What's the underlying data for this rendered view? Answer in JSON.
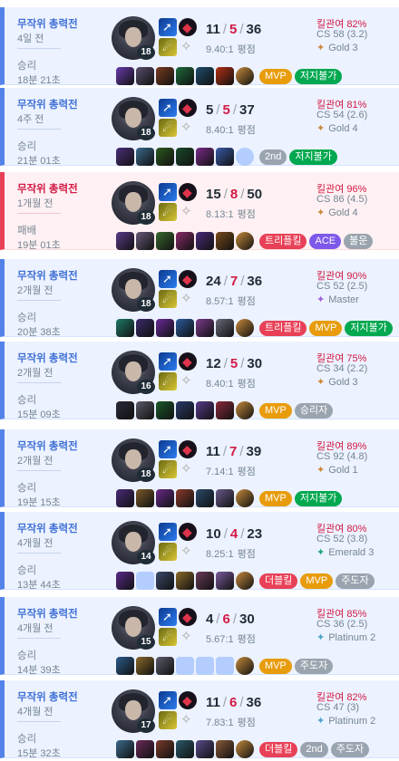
{
  "matches": [
    {
      "result_type": "win",
      "mode": "무작위 총력전",
      "time_ago": "4일 전",
      "result": "승리",
      "duration": "18분 21초",
      "level": "18",
      "kills": "11",
      "deaths": "5",
      "assists": "36",
      "ratio": "9.40:1",
      "ratio_suffix": "평점",
      "kp_label": "킬관여",
      "kp": "82%",
      "cs": "CS 58 (3.2)",
      "tier": "Gold 3",
      "items": [
        {
          "color": "#6a3bb0"
        },
        {
          "color": "#5a4f6c"
        },
        {
          "color": "#7a3b1f"
        },
        {
          "color": "#1e6b3c"
        },
        {
          "color": "#1f4d6e"
        },
        {
          "color": "#b43014"
        },
        {
          "color": "#c68a3c",
          "ward": true
        }
      ],
      "badges": [
        {
          "label": "MVP",
          "color": "#e89c0c"
        },
        {
          "label": "저지불가",
          "color": "#00a84f"
        }
      ]
    },
    {
      "result_type": "win",
      "mode": "무작위 총력전",
      "time_ago": "4주 전",
      "result": "승리",
      "duration": "21분 01초",
      "level": "18",
      "kills": "5",
      "deaths": "5",
      "assists": "37",
      "ratio": "8.40:1",
      "ratio_suffix": "평점",
      "kp_label": "킬관여",
      "kp": "81%",
      "cs": "CS 54 (2.6)",
      "tier": "Gold 4",
      "items": [
        {
          "color": "#4b2f7a"
        },
        {
          "color": "#3a6a8c"
        },
        {
          "color": "#2d5a1f"
        },
        {
          "color": "#1a4a2a"
        },
        {
          "color": "#7a2b8a"
        },
        {
          "color": "#3a5aa8"
        },
        {
          "color": "#b3cdff",
          "empty": true,
          "ward": true
        }
      ],
      "badges": [
        {
          "label": "2nd",
          "color": "#9aa4af"
        },
        {
          "label": "저지불가",
          "color": "#00a84f"
        }
      ]
    },
    {
      "result_type": "loss",
      "mode": "무작위 총력전",
      "time_ago": "1개월 전",
      "result": "패배",
      "duration": "19분 01초",
      "level": "18",
      "kills": "15",
      "deaths": "8",
      "assists": "50",
      "ratio": "8.13:1",
      "ratio_suffix": "평점",
      "kp_label": "킬관여",
      "kp": "96%",
      "cs": "CS 86 (4.5)",
      "tier": "Gold 4",
      "items": [
        {
          "color": "#5b3a8a"
        },
        {
          "color": "#6a5a7a"
        },
        {
          "color": "#3a6a2f"
        },
        {
          "color": "#8a2a6a"
        },
        {
          "color": "#4a2a7a"
        },
        {
          "color": "#7a4a1a"
        },
        {
          "color": "#c68a3c",
          "ward": true
        }
      ],
      "badges": [
        {
          "label": "트리플킬",
          "color": "#e84057"
        },
        {
          "label": "ACE",
          "color": "#7d59ea"
        },
        {
          "label": "불운",
          "color": "#9aa4af"
        }
      ]
    },
    {
      "result_type": "win",
      "mode": "무작위 총력전",
      "time_ago": "2개월 전",
      "result": "승리",
      "duration": "20분 38초",
      "level": "18",
      "kills": "24",
      "deaths": "7",
      "assists": "36",
      "ratio": "8.57:1",
      "ratio_suffix": "평점",
      "kp_label": "킬관여",
      "kp": "90%",
      "cs": "CS 52 (2.5)",
      "tier": "Master",
      "items": [
        {
          "color": "#1f7a6a"
        },
        {
          "color": "#3a2a6a"
        },
        {
          "color": "#6a2a9a"
        },
        {
          "color": "#2a5a9a"
        },
        {
          "color": "#7a3a8a"
        },
        {
          "color": "#6a6a7a"
        },
        {
          "color": "#c68a3c",
          "ward": true
        }
      ],
      "badges": [
        {
          "label": "트리플킬",
          "color": "#e84057"
        },
        {
          "label": "MVP",
          "color": "#e89c0c"
        },
        {
          "label": "저지불가",
          "color": "#00a84f"
        }
      ]
    },
    {
      "result_type": "win",
      "mode": "무작위 총력전",
      "time_ago": "2개월 전",
      "result": "승리",
      "duration": "15분 09초",
      "level": "16",
      "kills": "12",
      "deaths": "5",
      "assists": "30",
      "ratio": "8.40:1",
      "ratio_suffix": "평점",
      "kp_label": "킬관여",
      "kp": "75%",
      "cs": "CS 34 (2.2)",
      "tier": "Gold 3",
      "items": [
        {
          "color": "#2a2a3a"
        },
        {
          "color": "#5a5a6a"
        },
        {
          "color": "#1a5a2a"
        },
        {
          "color": "#2a3a6a"
        },
        {
          "color": "#5a3a8a"
        },
        {
          "color": "#8a2a3a"
        },
        {
          "color": "#c68a3c",
          "ward": true
        }
      ],
      "badges": [
        {
          "label": "MVP",
          "color": "#e89c0c"
        },
        {
          "label": "승리자",
          "color": "#9aa4af"
        }
      ]
    },
    {
      "result_type": "win",
      "mode": "무작위 총력전",
      "time_ago": "2개월 전",
      "result": "승리",
      "duration": "19분 15초",
      "level": "18",
      "kills": "11",
      "deaths": "7",
      "assists": "39",
      "ratio": "7.14:1",
      "ratio_suffix": "평점",
      "kp_label": "킬관여",
      "kp": "89%",
      "cs": "CS 92 (4.8)",
      "tier": "Gold 1",
      "items": [
        {
          "color": "#4a2a7a"
        },
        {
          "color": "#7a5a2a"
        },
        {
          "color": "#6a2a8a"
        },
        {
          "color": "#8a3a2a"
        },
        {
          "color": "#2a4a6a"
        },
        {
          "color": "#6a5a8a"
        },
        {
          "color": "#c68a3c",
          "ward": true
        }
      ],
      "badges": [
        {
          "label": "MVP",
          "color": "#e89c0c"
        },
        {
          "label": "저지불가",
          "color": "#00a84f"
        }
      ]
    },
    {
      "result_type": "win",
      "mode": "무작위 총력전",
      "time_ago": "4개월 전",
      "result": "승리",
      "duration": "13분 44초",
      "level": "14",
      "kills": "10",
      "deaths": "4",
      "assists": "23",
      "ratio": "8.25:1",
      "ratio_suffix": "평점",
      "kp_label": "킬관여",
      "kp": "80%",
      "cs": "CS 52 (3.8)",
      "tier": "Emerald 3",
      "items": [
        {
          "color": "#5a2a8a"
        },
        {
          "color": "#b3cdff",
          "empty": true
        },
        {
          "color": "#3a4a6a"
        },
        {
          "color": "#8a6a2a"
        },
        {
          "color": "#6a3a5a"
        },
        {
          "color": "#7a5a9a"
        },
        {
          "color": "#c68a3c",
          "ward": true
        }
      ],
      "badges": [
        {
          "label": "더블킬",
          "color": "#e84057"
        },
        {
          "label": "MVP",
          "color": "#e89c0c"
        },
        {
          "label": "주도자",
          "color": "#9aa4af"
        }
      ]
    },
    {
      "result_type": "win",
      "mode": "무작위 총력전",
      "time_ago": "4개월 전",
      "result": "승리",
      "duration": "14분 39초",
      "level": "15",
      "kills": "4",
      "deaths": "6",
      "assists": "30",
      "ratio": "5.67:1",
      "ratio_suffix": "평점",
      "kp_label": "킬관여",
      "kp": "85%",
      "cs": "CS 36 (2.5)",
      "tier": "Platinum 2",
      "items": [
        {
          "color": "#2a5a8a"
        },
        {
          "color": "#8a6a2a"
        },
        {
          "color": "#5a5a6a"
        },
        {
          "color": "#b3cdff",
          "empty": true
        },
        {
          "color": "#b3cdff",
          "empty": true
        },
        {
          "color": "#b3cdff",
          "empty": true
        },
        {
          "color": "#c68a3c",
          "ward": true
        }
      ],
      "badges": [
        {
          "label": "MVP",
          "color": "#e89c0c"
        },
        {
          "label": "주도자",
          "color": "#9aa4af"
        }
      ]
    },
    {
      "result_type": "win",
      "mode": "무작위 총력전",
      "time_ago": "4개월 전",
      "result": "승리",
      "duration": "15분 32초",
      "level": "17",
      "kills": "11",
      "deaths": "6",
      "assists": "36",
      "ratio": "7.83:1",
      "ratio_suffix": "평점",
      "kp_label": "킬관여",
      "kp": "82%",
      "cs": "CS 47 (3)",
      "tier": "Platinum 2",
      "items": [
        {
          "color": "#3a6a8a"
        },
        {
          "color": "#6a2a5a"
        },
        {
          "color": "#7a3a2a"
        },
        {
          "color": "#2a5a6a"
        },
        {
          "color": "#5a4a8a"
        },
        {
          "color": "#8a5a3a"
        },
        {
          "color": "#c68a3c",
          "ward": true
        }
      ],
      "badges": [
        {
          "label": "더블킬",
          "color": "#e84057"
        },
        {
          "label": "2nd",
          "color": "#9aa4af"
        },
        {
          "label": "주도자",
          "color": "#9aa4af"
        }
      ]
    }
  ],
  "tier_colors": {
    "Gold": "#c98a3c",
    "Master": "#a05cd6",
    "Emerald": "#1fa37a",
    "Platinum": "#4aa3c8"
  }
}
